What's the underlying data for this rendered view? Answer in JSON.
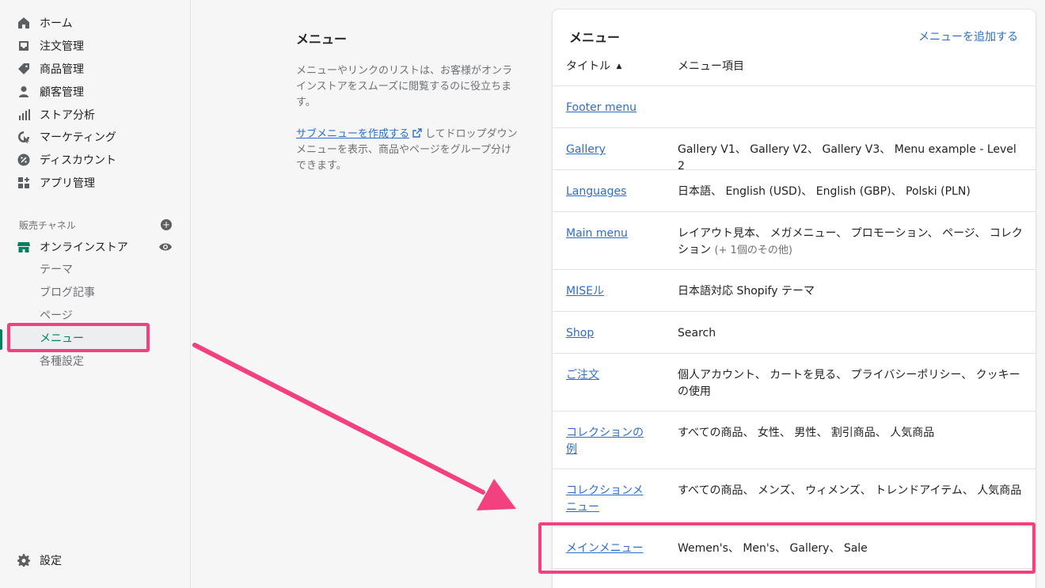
{
  "sidebar": {
    "items": [
      {
        "label": "ホーム",
        "icon": "home-icon"
      },
      {
        "label": "注文管理",
        "icon": "inbox-icon"
      },
      {
        "label": "商品管理",
        "icon": "tag-icon"
      },
      {
        "label": "顧客管理",
        "icon": "person-icon"
      },
      {
        "label": "ストア分析",
        "icon": "bar-chart-icon"
      },
      {
        "label": "マーケティング",
        "icon": "target-icon"
      },
      {
        "label": "ディスカウント",
        "icon": "discount-icon"
      },
      {
        "label": "アプリ管理",
        "icon": "apps-icon"
      }
    ],
    "channels_label": "販売チャネル",
    "online_store": "オンラインストア",
    "sub_items": [
      "テーマ",
      "ブログ記事",
      "ページ",
      "メニュー",
      "各種設定"
    ],
    "settings": "設定"
  },
  "description": {
    "title": "メニュー",
    "text": "メニューやリンクのリストは、お客様がオンラインストアをスムーズに閲覧するのに役立ちます。",
    "link": "サブメニューを作成する",
    "link_suffix": "してドロップダウンメニューを表示、商品やページをグループ分けできます。"
  },
  "card": {
    "title": "メニュー",
    "add_link": "メニューを追加する",
    "col_title": "タイトル",
    "col_items": "メニュー項目",
    "sort_indicator": "▲",
    "rows": [
      {
        "title": "Footer menu",
        "items": ""
      },
      {
        "title": "Gallery",
        "items": "Gallery V1、 Gallery V2、 Gallery V3、 Menu example - Level 2"
      },
      {
        "title": "Languages",
        "items": "日本語、 English (USD)、 English (GBP)、 Polski (PLN)"
      },
      {
        "title": "Main menu",
        "items": "レイアウト見本、 メガメニュー、 プロモーション、 ページ、 コレクション",
        "more": "(+ 1個のその他)"
      },
      {
        "title": "MISEル",
        "items": "日本語対応 Shopify テーマ"
      },
      {
        "title": "Shop",
        "items": "Search"
      },
      {
        "title": "ご注文",
        "items": "個人アカウント、 カートを見る、 プライバシーポリシー、 クッキーの使用"
      },
      {
        "title": "コレクションの例",
        "items": "すべての商品、 女性、 男性、 割引商品、 人気商品"
      },
      {
        "title": "コレクションメニュー",
        "items": "すべての商品、 メンズ、 ウィメンズ、 トレンドアイテム、 人気商品"
      },
      {
        "title": "メインメニュー",
        "items": "Wemen's、 Men's、 Gallery、 Sale"
      }
    ]
  },
  "colors": {
    "accent": "#008060",
    "link": "#2c6ecb",
    "annotation": "#f2417e"
  }
}
